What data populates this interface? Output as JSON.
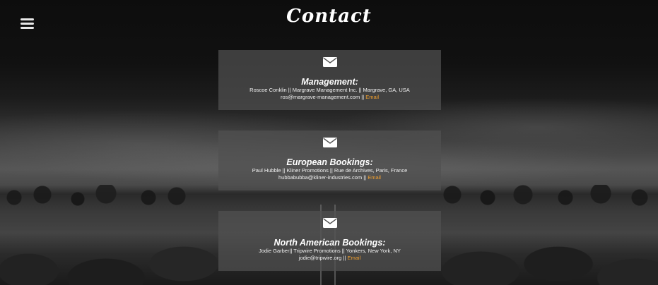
{
  "page": {
    "title": "Contact"
  },
  "nav": {
    "menu_icon": "hamburger-menu-icon"
  },
  "icons": {
    "card_icon": "envelope-icon"
  },
  "colors": {
    "link": "#f0a030",
    "card_background": "#505050"
  },
  "contacts": [
    {
      "heading": "Management:",
      "details": "Roscoe Conklin || Margrave Management Inc. || Margrave, GA, USA",
      "email": "ros@margrave-management.com",
      "separator": " || ",
      "link_label": "Email"
    },
    {
      "heading": "European Bookings:",
      "details": "Paul Hubble || Kliner Promotions || Rue de Archives, Paris, France",
      "email": "hubbabubba@kliner-industries.com",
      "separator": " || ",
      "link_label": "Email"
    },
    {
      "heading": "North American Bookings:",
      "details": "Jodie Garber|| Tripwire Promotions || Yonkers, New York, NY",
      "email": "jodie@tripwire.org",
      "separator": " || ",
      "link_label": "Email"
    }
  ]
}
